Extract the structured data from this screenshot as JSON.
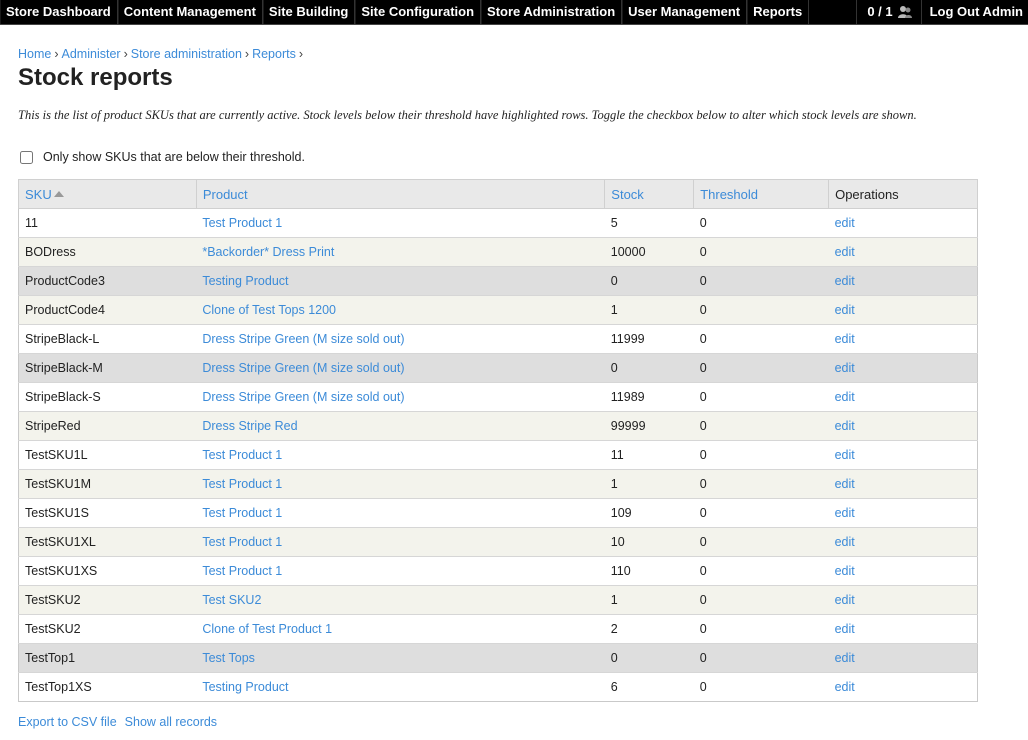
{
  "topbar": {
    "menu": [
      "Store Dashboard",
      "Content Management",
      "Site Building",
      "Site Configuration",
      "Store Administration",
      "User Management",
      "Reports"
    ],
    "users_count": "0 / 1",
    "logout": "Log Out Admin"
  },
  "breadcrumb": [
    "Home",
    "Administer",
    "Store administration",
    "Reports"
  ],
  "title": "Stock reports",
  "description": "This is the list of product SKUs that are currently active. Stock levels below their threshold have highlighted rows. Toggle the checkbox below to alter which stock levels are shown.",
  "filter_label": "Only show SKUs that are below their threshold.",
  "table": {
    "headers": [
      "SKU",
      "Product",
      "Stock",
      "Threshold",
      "Operations"
    ],
    "rows": [
      {
        "sku": "11",
        "product": "Test Product 1",
        "stock": "5",
        "threshold": "0",
        "op": "edit",
        "low": false
      },
      {
        "sku": "BODress",
        "product": "*Backorder* Dress Print",
        "stock": "10000",
        "threshold": "0",
        "op": "edit",
        "low": false
      },
      {
        "sku": "ProductCode3",
        "product": "Testing Product",
        "stock": "0",
        "threshold": "0",
        "op": "edit",
        "low": true
      },
      {
        "sku": "ProductCode4",
        "product": "Clone of Test Tops 1200",
        "stock": "1",
        "threshold": "0",
        "op": "edit",
        "low": false
      },
      {
        "sku": "StripeBlack-L",
        "product": "Dress Stripe Green (M size sold out)",
        "stock": "11999",
        "threshold": "0",
        "op": "edit",
        "low": false
      },
      {
        "sku": "StripeBlack-M",
        "product": "Dress Stripe Green (M size sold out)",
        "stock": "0",
        "threshold": "0",
        "op": "edit",
        "low": true
      },
      {
        "sku": "StripeBlack-S",
        "product": "Dress Stripe Green (M size sold out)",
        "stock": "11989",
        "threshold": "0",
        "op": "edit",
        "low": false
      },
      {
        "sku": "StripeRed",
        "product": "Dress Stripe Red",
        "stock": "99999",
        "threshold": "0",
        "op": "edit",
        "low": false
      },
      {
        "sku": "TestSKU1L",
        "product": "Test Product 1",
        "stock": "11",
        "threshold": "0",
        "op": "edit",
        "low": false
      },
      {
        "sku": "TestSKU1M",
        "product": "Test Product 1",
        "stock": "1",
        "threshold": "0",
        "op": "edit",
        "low": false
      },
      {
        "sku": "TestSKU1S",
        "product": "Test Product 1",
        "stock": "109",
        "threshold": "0",
        "op": "edit",
        "low": false
      },
      {
        "sku": "TestSKU1XL",
        "product": "Test Product 1",
        "stock": "10",
        "threshold": "0",
        "op": "edit",
        "low": false
      },
      {
        "sku": "TestSKU1XS",
        "product": "Test Product 1",
        "stock": "110",
        "threshold": "0",
        "op": "edit",
        "low": false
      },
      {
        "sku": "TestSKU2",
        "product": "Test SKU2",
        "stock": "1",
        "threshold": "0",
        "op": "edit",
        "low": false
      },
      {
        "sku": "TestSKU2",
        "product": "Clone of Test Product 1",
        "stock": "2",
        "threshold": "0",
        "op": "edit",
        "low": false
      },
      {
        "sku": "TestTop1",
        "product": "Test Tops",
        "stock": "0",
        "threshold": "0",
        "op": "edit",
        "low": true
      },
      {
        "sku": "TestTop1XS",
        "product": "Testing Product",
        "stock": "6",
        "threshold": "0",
        "op": "edit",
        "low": false
      }
    ]
  },
  "footer": {
    "export": "Export to CSV file",
    "show_all": "Show all records"
  },
  "icons": {
    "users": "people-icon"
  },
  "colors": {
    "link": "#3c8bd8",
    "topbar_bg": "#000000",
    "low_row_bg": "#dedede",
    "even_row_bg": "#f3f3ec"
  }
}
